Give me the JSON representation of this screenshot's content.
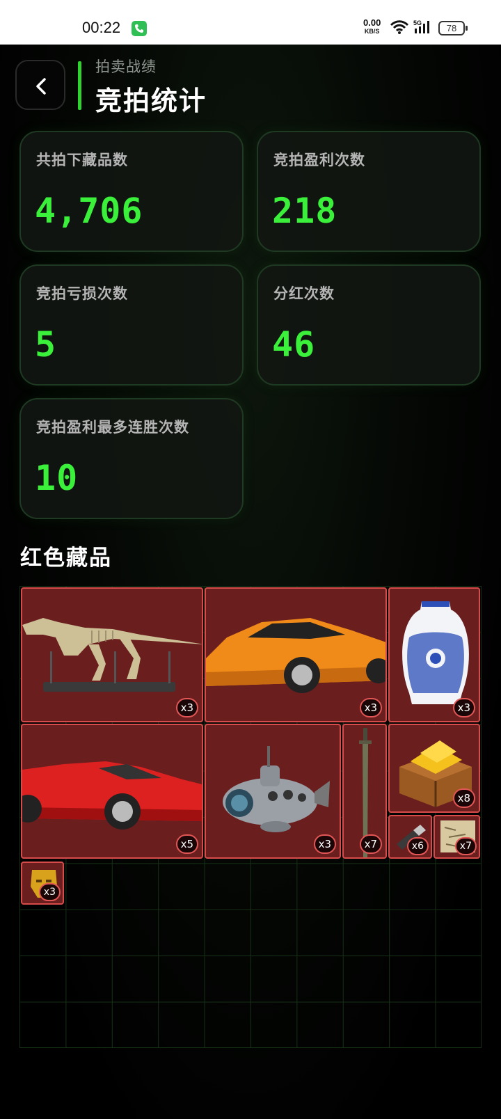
{
  "status_bar": {
    "time": "00:22",
    "net_speed": "0.00",
    "net_unit": "KB/S",
    "signal_label": "5G",
    "battery": "78"
  },
  "header": {
    "subtitle": "拍卖战绩",
    "title": "竞拍统计"
  },
  "stats": [
    {
      "label": "共拍下藏品数",
      "value": "4,706"
    },
    {
      "label": "竞拍盈利次数",
      "value": "218"
    },
    {
      "label": "竞拍亏损次数",
      "value": "5"
    },
    {
      "label": "分红次数",
      "value": "46"
    },
    {
      "label": "竞拍盈利最多连胜次数",
      "value": "10"
    }
  ],
  "collection": {
    "title": "红色藏品",
    "items": [
      {
        "name": "dinosaur-skeleton",
        "count": "x3"
      },
      {
        "name": "orange-supercar",
        "count": "x3"
      },
      {
        "name": "blue-white-porcelain-vase",
        "count": "x3"
      },
      {
        "name": "red-ferrari",
        "count": "x5"
      },
      {
        "name": "submarine",
        "count": "x3"
      },
      {
        "name": "ancient-sword",
        "count": "x7"
      },
      {
        "name": "gold-bar-chest",
        "count": "x8"
      },
      {
        "name": "usb-drive",
        "count": "x6"
      },
      {
        "name": "treasure-map",
        "count": "x7"
      },
      {
        "name": "golden-mask",
        "count": "x3"
      }
    ]
  },
  "colors": {
    "accent_green": "#3bf03b",
    "item_red": "#d84b4b",
    "item_bg": "#6a1e1e"
  }
}
